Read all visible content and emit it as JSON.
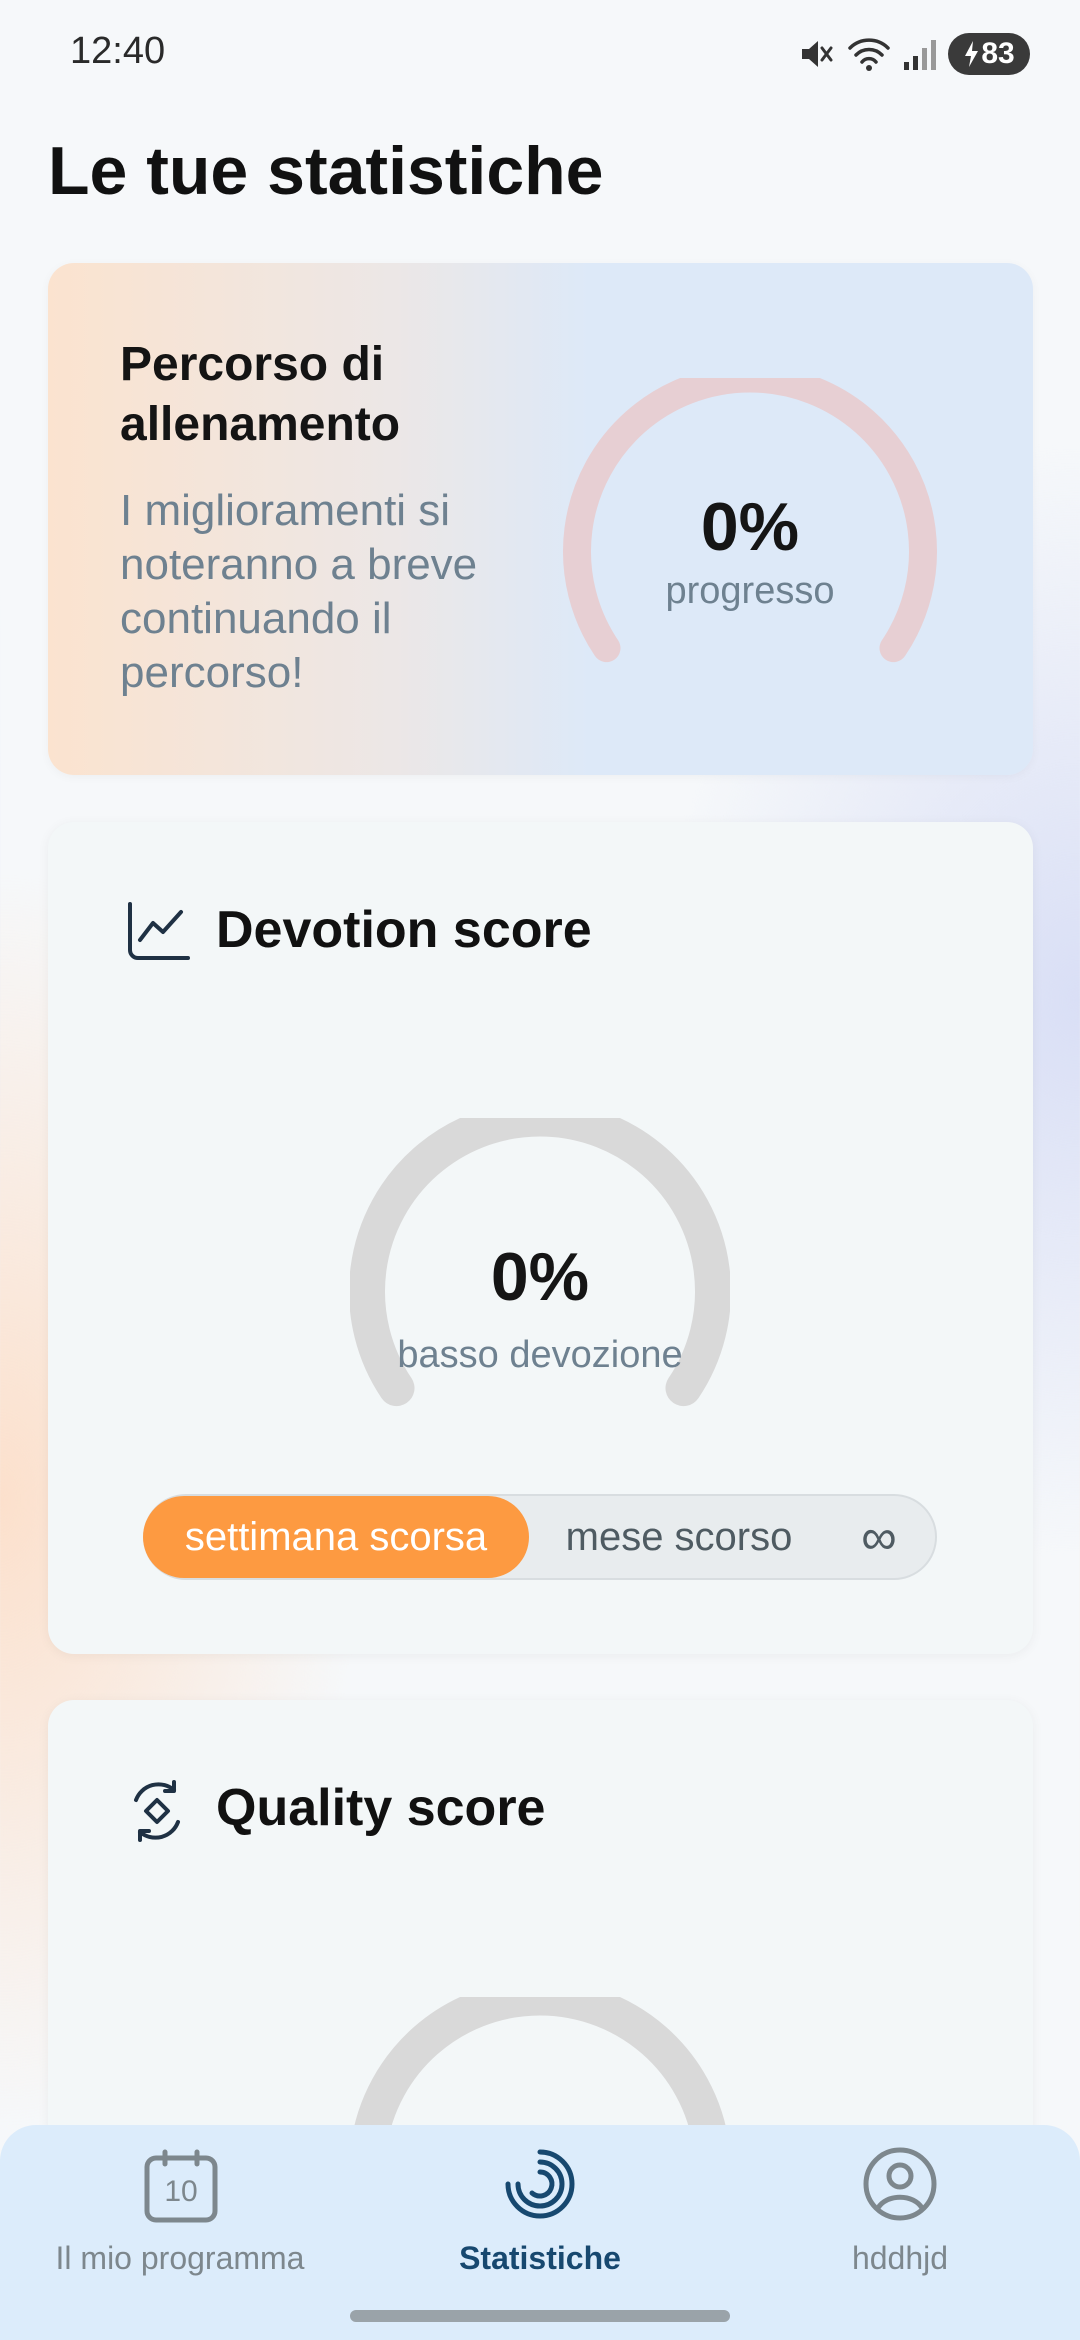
{
  "status_bar": {
    "time": "12:40",
    "battery": "83",
    "icons": [
      "mute-icon",
      "wifi-icon",
      "signal-icon",
      "battery-charging-icon"
    ]
  },
  "page": {
    "title": "Le tue statistiche"
  },
  "progress_card": {
    "title": "Percorso di allenamento",
    "description": "I miglioramenti si noteranno a breve continuando il percorso!",
    "gauge": {
      "value_text": "0%",
      "label": "progresso",
      "value": 0,
      "color": "#e7cfd3"
    }
  },
  "devotion_card": {
    "title": "Devotion score",
    "icon": "line-chart-icon",
    "gauge": {
      "value_text": "0%",
      "label": "basso devozione",
      "value": 0,
      "color": "#d9d9d9"
    },
    "periods": [
      {
        "label": "settimana scorsa",
        "selected": true
      },
      {
        "label": "mese scorso",
        "selected": false
      },
      {
        "label": "∞",
        "selected": false
      }
    ]
  },
  "quality_card": {
    "title": "Quality score",
    "icon": "quality-cycle-icon"
  },
  "bottom_nav": {
    "items": [
      {
        "label": "Il mio programma",
        "icon": "calendar-icon",
        "badge": "10",
        "active": false
      },
      {
        "label": "Statistiche",
        "icon": "stats-spiral-icon",
        "active": true
      },
      {
        "label": "hddhjd",
        "icon": "profile-icon",
        "active": false
      }
    ]
  },
  "colors": {
    "accent": "#fd9a41",
    "nav_active": "#17486f",
    "nav_background": "#dcecfb"
  }
}
